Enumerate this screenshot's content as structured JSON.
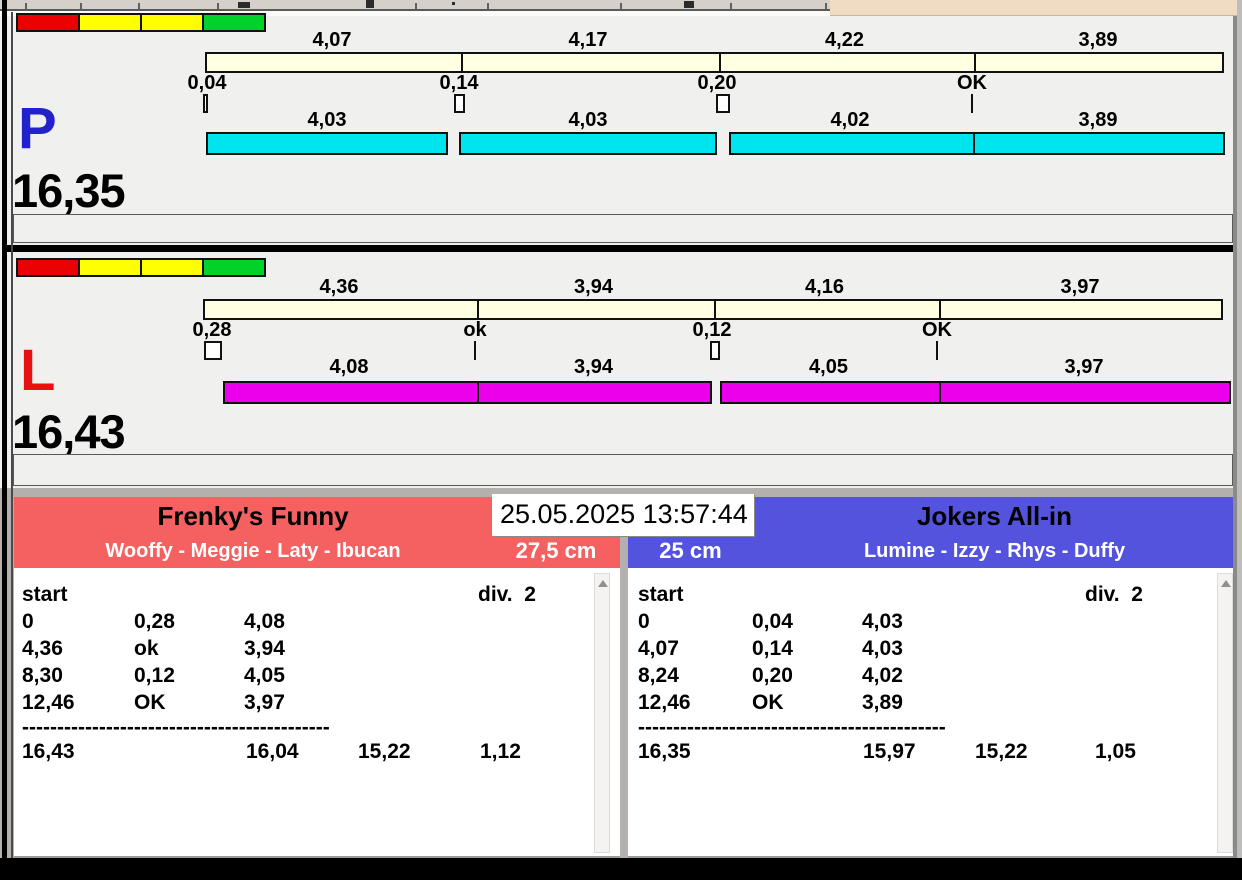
{
  "window": {
    "datetime": "25.05.2025 13:57:44"
  },
  "lanes": [
    {
      "label": "P",
      "total": "16,35",
      "splits_top": [
        "4,07",
        "4,17",
        "4,22",
        "3,89"
      ],
      "crossings": [
        "0,04",
        "0,14",
        "0,20",
        "OK"
      ],
      "splits_bottom": [
        "4,03",
        "4,03",
        "4,02",
        "3,89"
      ]
    },
    {
      "label": "L",
      "total": "16,43",
      "splits_top": [
        "4,36",
        "3,94",
        "4,16",
        "3,97"
      ],
      "crossings": [
        "0,28",
        "ok",
        "0,12",
        "OK"
      ],
      "splits_bottom": [
        "4,08",
        "3,94",
        "4,05",
        "3,97"
      ]
    }
  ],
  "teams": [
    {
      "name": "Frenky's Funny",
      "dogs": "Wooffy - Meggie - Laty - Ibucan",
      "size": "27,5 cm",
      "table": {
        "col_start": "start",
        "col_div": "div.  2",
        "rows": [
          [
            "0",
            "0,28",
            "4,08"
          ],
          [
            "4,36",
            "ok",
            "3,94"
          ],
          [
            "8,30",
            "0,12",
            "4,05"
          ],
          [
            "12,46",
            "OK",
            "3,97"
          ]
        ],
        "separator": "--------------------------------------------",
        "totals": [
          "16,43",
          "16,04",
          "15,22",
          "1,12"
        ]
      }
    },
    {
      "name": "Jokers All-in",
      "dogs": "Lumine - Izzy - Rhys - Duffy",
      "size": "25 cm",
      "table": {
        "col_start": "start",
        "col_div": "div.  2",
        "rows": [
          [
            "0",
            "0,04",
            "4,03"
          ],
          [
            "4,07",
            "0,14",
            "4,03"
          ],
          [
            "8,24",
            "0,20",
            "4,02"
          ],
          [
            "12,46",
            "OK",
            "3,89"
          ]
        ],
        "separator": "--------------------------------------------",
        "totals": [
          "16,35",
          "15,97",
          "15,22",
          "1,05"
        ]
      }
    }
  ],
  "colors": {
    "lane_p_letter": "#2222CC",
    "lane_l_letter": "#E81111",
    "split_bar": "#FFFFE2",
    "run_bar_p": "#00E4EE",
    "run_bar_l": "#EC00EC",
    "team_left_header": "#F56161",
    "team_right_header": "#5353DE",
    "traffic_lights": [
      "#EA0202",
      "#FFFF00",
      "#FFFF00",
      "#00D22A"
    ]
  }
}
